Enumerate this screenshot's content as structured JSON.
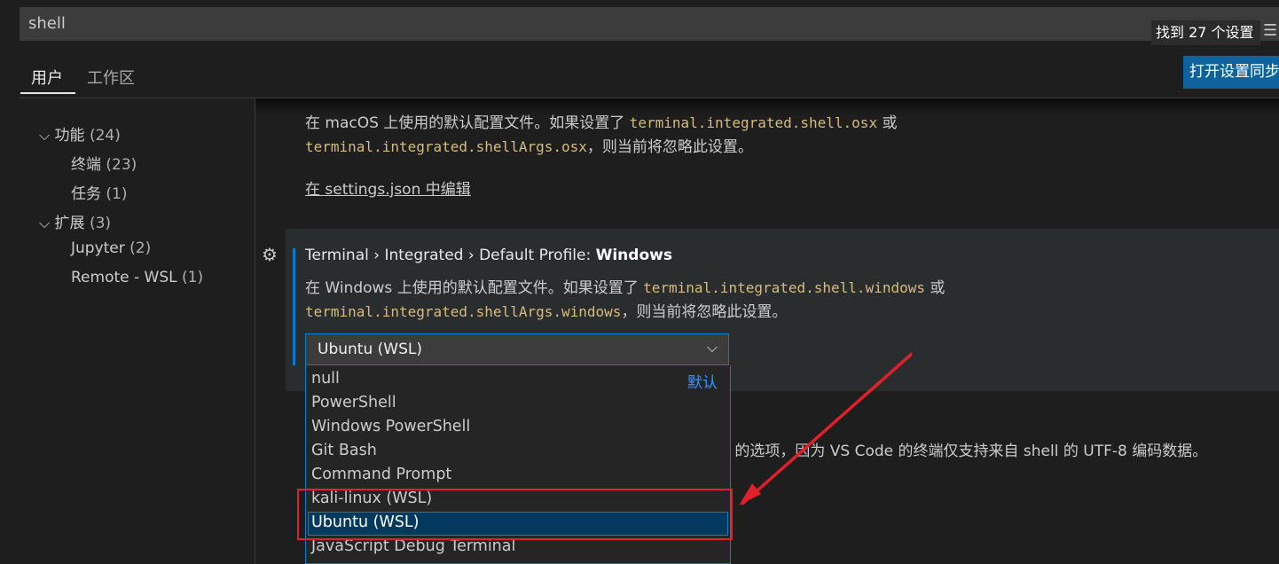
{
  "search": {
    "value": "shell",
    "result_count": "找到 27 个设置"
  },
  "tabs": [
    {
      "label": "用户"
    },
    {
      "label": "工作区"
    }
  ],
  "sync_button": "打开设置同步",
  "toc": [
    {
      "label": "功能",
      "count": "(24)",
      "level": 0,
      "expanded": true
    },
    {
      "label": "终端",
      "count": "(23)",
      "level": 1
    },
    {
      "label": "任务",
      "count": "(1)",
      "level": 1
    },
    {
      "label": "扩展",
      "count": "(3)",
      "level": 0,
      "expanded": true
    },
    {
      "label": "Jupyter",
      "count": "(2)",
      "level": 1
    },
    {
      "label": "Remote - WSL",
      "count": "(1)",
      "level": 1
    }
  ],
  "prev_setting": {
    "desc_part1": "在 macOS 上使用的默认配置文件。如果设置了",
    "code1": "terminal.integrated.shell.osx",
    "desc_part2": "或",
    "code2": "terminal.integrated.shellArgs.osx",
    "desc_part3": "，则当前将忽略此设置。",
    "edit_link": "在 settings.json 中编辑"
  },
  "setting": {
    "title_prefix": "Terminal › Integrated › Default Profile: ",
    "title_bold": "Windows",
    "desc_part1": "在 Windows 上使用的默认配置文件。如果设置了",
    "code1": "terminal.integrated.shell.windows",
    "desc_part2": "或",
    "code2": "terminal.integrated.shellArgs.windows",
    "desc_part3": "，则当前将忽略此设置。",
    "selected_value": "Ubuntu (WSL)",
    "default_tag": "默认",
    "options": [
      "null",
      "PowerShell",
      "Windows PowerShell",
      "Git Bash",
      "Command Prompt",
      "kali-linux (WSL)",
      "Ubuntu (WSL)",
      "JavaScript Debug Terminal"
    ]
  },
  "next_setting_partial": "-8 的选项，因为 VS Code 的终端仅支持来自 shell 的 UTF-8 编码数据。",
  "colors": {
    "accent": "#007fd4",
    "button": "#0e639c",
    "code": "#d7ba7d",
    "annotation": "#e0202a"
  }
}
